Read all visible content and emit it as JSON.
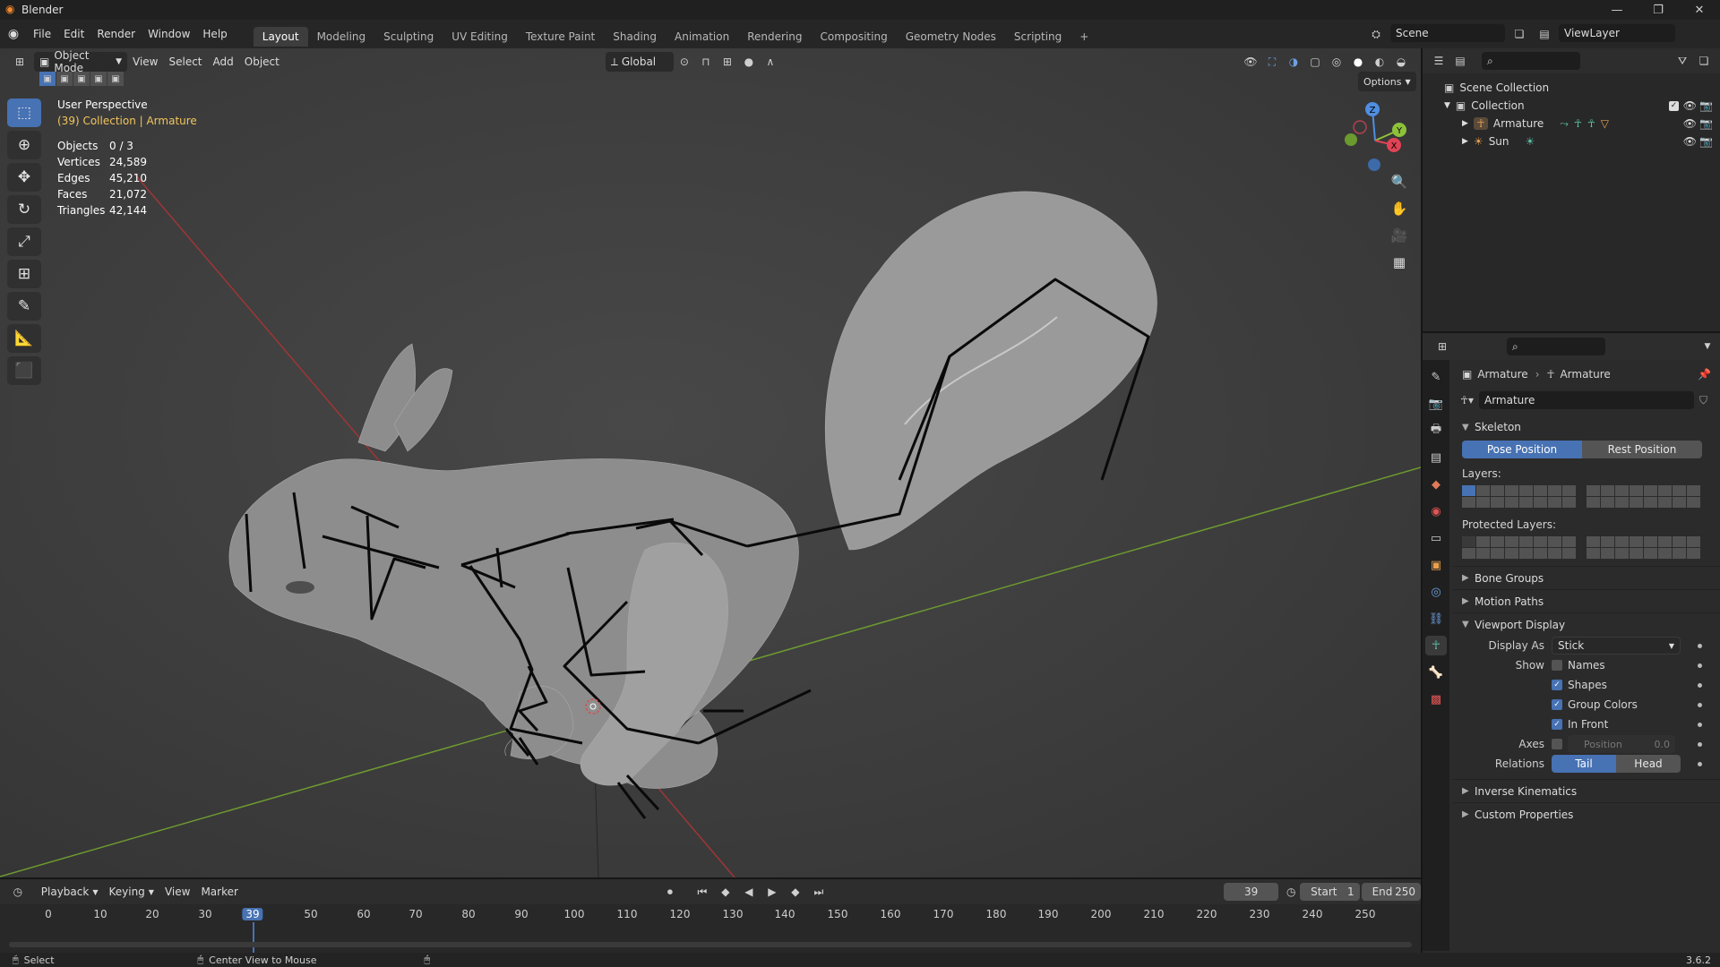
{
  "app": {
    "title": "Blender",
    "version": "3.6.2"
  },
  "menu": {
    "file": "File",
    "edit": "Edit",
    "render": "Render",
    "window": "Window",
    "help": "Help"
  },
  "workspaces": [
    "Layout",
    "Modeling",
    "Sculpting",
    "UV Editing",
    "Texture Paint",
    "Shading",
    "Animation",
    "Rendering",
    "Compositing",
    "Geometry Nodes",
    "Scripting"
  ],
  "active_workspace": "Layout",
  "scene": {
    "name": "Scene",
    "view_layer": "ViewLayer"
  },
  "viewport_header": {
    "mode": "Object Mode",
    "view": "View",
    "select": "Select",
    "add": "Add",
    "object": "Object",
    "orientation": "Global",
    "options": "Options"
  },
  "overlay": {
    "perspective": "User Perspective",
    "collection_info": "(39) Collection | Armature",
    "stats": [
      {
        "key": "Objects",
        "value": "0 / 3"
      },
      {
        "key": "Vertices",
        "value": "24,589"
      },
      {
        "key": "Edges",
        "value": "45,210"
      },
      {
        "key": "Faces",
        "value": "21,072"
      },
      {
        "key": "Triangles",
        "value": "42,144"
      }
    ]
  },
  "gizmo": {
    "x": "X",
    "y": "Y",
    "z": "Z"
  },
  "outliner": {
    "scene_collection": "Scene Collection",
    "collection": "Collection",
    "items": [
      "Armature",
      "Sun"
    ]
  },
  "properties": {
    "breadcrumb_object": "Armature",
    "breadcrumb_data": "Armature",
    "datablock": "Armature",
    "skeleton": "Skeleton",
    "pose_position": "Pose Position",
    "rest_position": "Rest Position",
    "layers": "Layers:",
    "protected_layers": "Protected Layers:",
    "bone_groups": "Bone Groups",
    "motion_paths": "Motion Paths",
    "viewport_display": "Viewport Display",
    "display_as_label": "Display As",
    "display_as_value": "Stick",
    "show_label": "Show",
    "names": "Names",
    "shapes": "Shapes",
    "group_colors": "Group Colors",
    "in_front": "In Front",
    "axes_label": "Axes",
    "position_label": "Position",
    "position_value": "0.0",
    "relations_label": "Relations",
    "tail": "Tail",
    "head": "Head",
    "inverse_kinematics": "Inverse Kinematics",
    "custom_properties": "Custom Properties"
  },
  "timeline": {
    "playback": "Playback",
    "keying": "Keying",
    "view": "View",
    "marker": "Marker",
    "current_frame": "39",
    "start_label": "Start",
    "start_value": "1",
    "end_label": "End",
    "end_value": "250",
    "ticks": [
      "0",
      "10",
      "20",
      "30",
      "39",
      "50",
      "60",
      "70",
      "80",
      "90",
      "100",
      "110",
      "120",
      "130",
      "140",
      "150",
      "160",
      "170",
      "180",
      "190",
      "200",
      "210",
      "220",
      "230",
      "240",
      "250"
    ]
  },
  "status": {
    "select": "Select",
    "center_view": "Center View to Mouse"
  },
  "colors": {
    "accent": "#4772b3",
    "viewport_bg": "#3d3d3d",
    "header": "#262626",
    "collection_info": "#f2c55c"
  }
}
